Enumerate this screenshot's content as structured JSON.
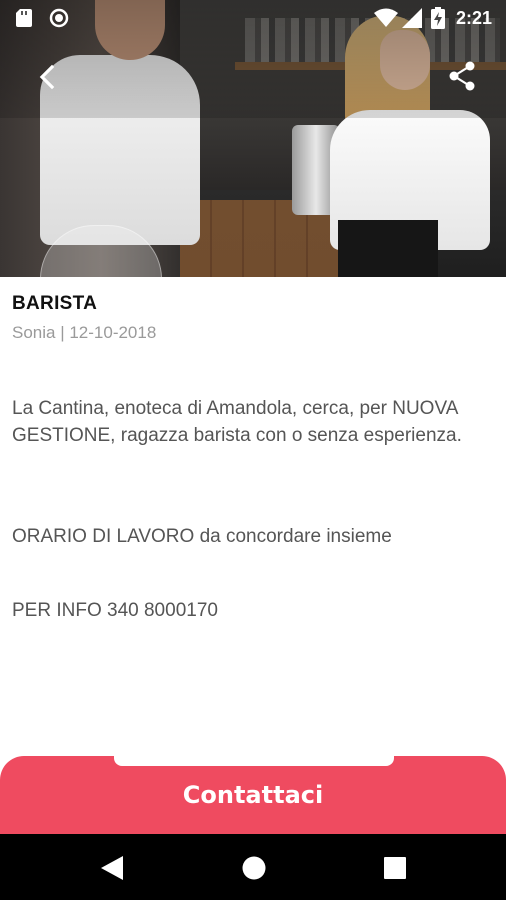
{
  "status_bar": {
    "time": "2:21",
    "icons": [
      "sd-card-icon",
      "record-icon",
      "wifi-icon",
      "signal-icon",
      "battery-charging-icon"
    ]
  },
  "app_bar": {
    "back_icon": "arrow-back-icon",
    "share_icon": "share-icon"
  },
  "post": {
    "title": "BARISTA",
    "meta": "Sonia | 12-10-2018",
    "paragraphs": [
      "La Cantina, enoteca di Amandola, cerca, per NUOVA GESTIONE, ragazza barista con o senza esperienza.",
      "ORARIO DI LAVORO da concordare insieme",
      "PER INFO 340 8000170"
    ]
  },
  "cta": {
    "label": "Contattaci",
    "color": "#ef4b60"
  },
  "nav_bar": {
    "icons": [
      "nav-back-icon",
      "nav-home-icon",
      "nav-recents-icon"
    ]
  }
}
